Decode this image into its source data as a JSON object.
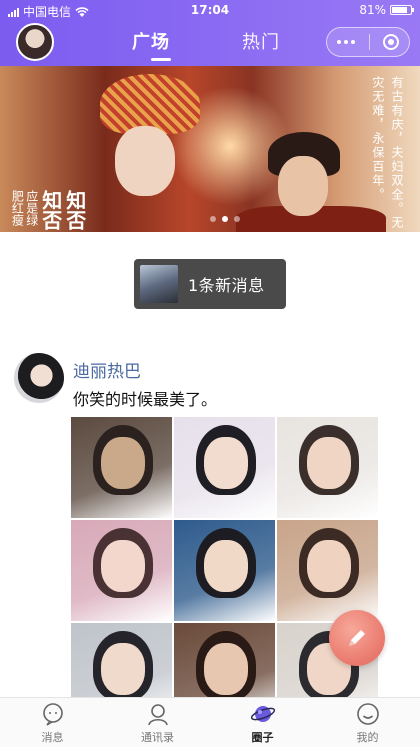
{
  "status_bar": {
    "carrier": "中国电信",
    "time": "17:04",
    "battery": "81%",
    "battery_level": 0.81
  },
  "nav": {
    "tabs": [
      {
        "label": "广场",
        "active": true
      },
      {
        "label": "热门",
        "active": false
      }
    ]
  },
  "banner": {
    "left_title": "知否知否",
    "left_subtitle": "应是绿肥红瘦",
    "right_text": "有古有庆，夫妇双全。无灾无难，永保百年。",
    "slides": 3,
    "active_slide": 1
  },
  "new_message": {
    "label": "1条新消息"
  },
  "post": {
    "author": "迪丽热巴",
    "text": "你笑的时候最美了。",
    "image_count": 9
  },
  "colors": {
    "accent": "#8a6af2",
    "author_link": "#4b6aa1",
    "fab": "#e9786c"
  },
  "tabbar": {
    "items": [
      {
        "label": "消息",
        "icon": "chat-bubble-icon"
      },
      {
        "label": "通讯录",
        "icon": "contacts-icon"
      },
      {
        "label": "圈子",
        "icon": "planet-icon",
        "active": true
      },
      {
        "label": "我的",
        "icon": "smile-icon"
      }
    ]
  }
}
